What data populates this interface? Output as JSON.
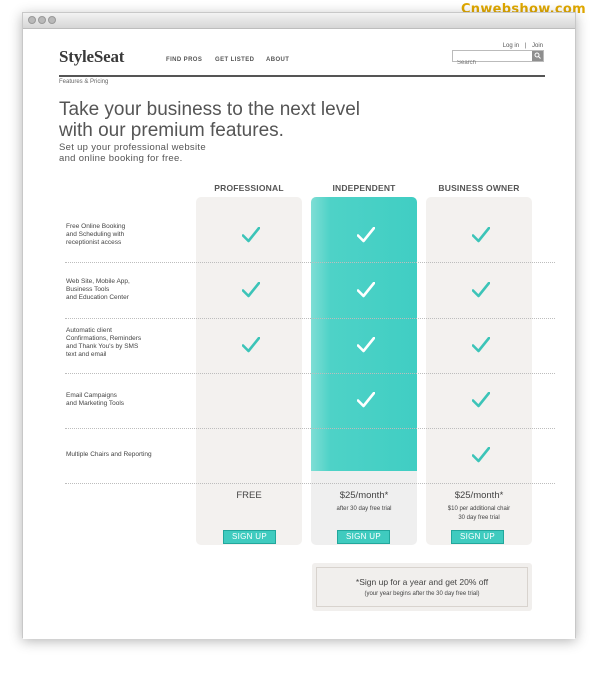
{
  "watermark": "Cnwebshow.com",
  "header": {
    "logo": "StyleSeat",
    "login": "Log in",
    "separator": "|",
    "join": "Join",
    "nav": [
      "FIND PROS",
      "GET LISTED",
      "ABOUT"
    ],
    "search_placeholder": "Search",
    "breadcrumb": "Features & Pricing"
  },
  "hero": {
    "headline_1": "Take your business to the next level",
    "headline_2": "with our premium features.",
    "subline_1": "Set up your professional website",
    "subline_2": "and online booking for free."
  },
  "plans": [
    {
      "name": "PROFESSIONAL",
      "price": "FREE",
      "note_1": "",
      "note_2": "",
      "cta": "SIGN UP"
    },
    {
      "name": "INDEPENDENT",
      "price": "$25/month*",
      "note_1": "after 30 day free trial",
      "note_2": "",
      "cta": "SIGN UP"
    },
    {
      "name": "BUSINESS OWNER",
      "price": "$25/month*",
      "note_1": "$10 per additional chair",
      "note_2": "30 day free trial",
      "cta": "SIGN UP"
    }
  ],
  "features": [
    {
      "lines": [
        "Free Online Booking",
        "and Scheduling with",
        "receptionist access"
      ],
      "included": [
        true,
        true,
        true
      ]
    },
    {
      "lines": [
        "Web Site, Mobile App,",
        "Business Tools",
        "and Education Center"
      ],
      "included": [
        true,
        true,
        true
      ]
    },
    {
      "lines": [
        "Automatic client",
        "Confirmations, Reminders",
        "and Thank You's by SMS",
        "text and email"
      ],
      "included": [
        true,
        true,
        true
      ]
    },
    {
      "lines": [
        "Email Campaigns",
        "and Marketing Tools"
      ],
      "included": [
        false,
        true,
        true
      ]
    },
    {
      "lines": [
        "Multiple Chairs and Reporting"
      ],
      "included": [
        false,
        false,
        true
      ]
    }
  ],
  "promo": {
    "main": "*Sign up for a year and get 20% off",
    "sub": "(your year begins after the 30 day free trial)"
  },
  "colors": {
    "accent": "#40cec3",
    "button": "#3fcbbf",
    "check": "#3cc4b8",
    "card": "#f3f1ef"
  }
}
